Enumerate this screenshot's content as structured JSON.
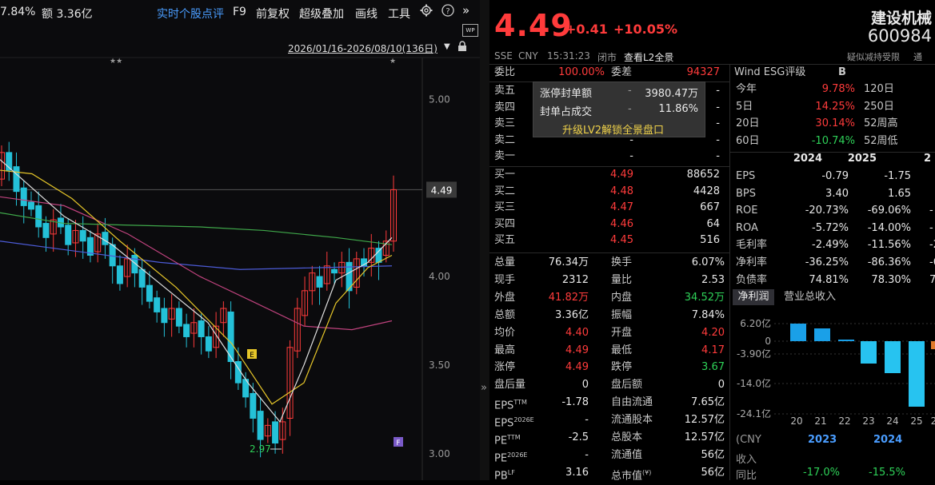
{
  "chart": {
    "toolbar": {
      "left_text_pct": "7.84%",
      "left_text_amount": "额 3.36亿",
      "items": [
        "实时个股点评",
        "F9",
        "前复权",
        "超级叠加",
        "画线",
        "工具"
      ],
      "date_range": "2026/01/16-2026/08/10(136日)",
      "stars_left": "★★",
      "star_right": "★",
      "wp_icon": "WP"
    },
    "price_axis": [
      "5.00",
      "4.49",
      "4.00",
      "3.50",
      "3.00"
    ],
    "current_price_tag": "4.49",
    "low_label": "2.97",
    "marker_e": "E",
    "marker_f": "F",
    "colors": {
      "up": "#ff3b3b",
      "down": "#24c1d8",
      "ma_white": "#e0e0e0",
      "ma_yellow": "#e6c629",
      "ma_magenta": "#c0437e",
      "ma_green": "#3fa84a",
      "ma_blue": "#4c5bd6"
    }
  },
  "chart_data": {
    "type": "candlestick",
    "ylim": [
      2.9,
      5.2
    ],
    "y_ticks": [
      3.0,
      3.5,
      4.0,
      4.49,
      5.0
    ],
    "low_marker": 2.97,
    "current_price": 4.49
  },
  "quote": {
    "price": "4.49",
    "change": "+0.41",
    "change_pct": "+10.05%",
    "name": "建设机械",
    "code": "600984",
    "meta": {
      "exchange": "SSE",
      "currency": "CNY",
      "time": "15:31:23",
      "status": "闭市",
      "l2_link": "查看L2全景",
      "note": "疑似减持受限",
      "note2": "通"
    },
    "order_header": {
      "label": "委比",
      "value": "100.00%",
      "label2": "委差",
      "value2": "94327"
    },
    "asks": [
      {
        "label": "卖五",
        "price": "",
        "vol": "-"
      },
      {
        "label": "卖四",
        "price": "",
        "vol": "-"
      },
      {
        "label": "卖三",
        "price": "-",
        "vol": "-"
      },
      {
        "label": "卖二",
        "price": "-",
        "vol": "-"
      },
      {
        "label": "卖一",
        "price": "-",
        "vol": "-"
      }
    ],
    "popup": {
      "row1_label": "涨停封单额",
      "row1_dash": "-",
      "row1_value": "3980.47万",
      "row2_label": "封单占成交",
      "row2_dash": "-",
      "row2_value": "11.86%",
      "upgrade": "升级LV2解锁全景盘口"
    },
    "bids": [
      {
        "label": "买一",
        "price": "4.49",
        "vol": "88652"
      },
      {
        "label": "买二",
        "price": "4.48",
        "vol": "4428"
      },
      {
        "label": "买三",
        "price": "4.47",
        "vol": "667"
      },
      {
        "label": "买四",
        "price": "4.46",
        "vol": "64"
      },
      {
        "label": "买五",
        "price": "4.45",
        "vol": "516"
      }
    ],
    "stats": [
      {
        "l1": "总量",
        "v1": "76.34万",
        "c1": "white",
        "l2": "换手",
        "v2": "6.07%",
        "c2": "white"
      },
      {
        "l1": "现手",
        "v1": "2312",
        "c1": "white",
        "l2": "量比",
        "v2": "2.53",
        "c2": "white"
      },
      {
        "l1": "外盘",
        "v1": "41.82万",
        "c1": "red",
        "l2": "内盘",
        "v2": "34.52万",
        "c2": "green"
      },
      {
        "l1": "总额",
        "v1": "3.36亿",
        "c1": "white",
        "l2": "振幅",
        "v2": "7.84%",
        "c2": "white"
      },
      {
        "l1": "均价",
        "v1": "4.40",
        "c1": "red",
        "l2": "开盘",
        "v2": "4.20",
        "c2": "red"
      },
      {
        "l1": "最高",
        "v1": "4.49",
        "c1": "red",
        "l2": "最低",
        "v2": "4.17",
        "c2": "red"
      },
      {
        "l1": "涨停",
        "v1": "4.49",
        "c1": "red",
        "l2": "跌停",
        "v2": "3.67",
        "c2": "green"
      },
      {
        "l1": "盘后量",
        "v1": "0",
        "c1": "white",
        "l2": "盘后额",
        "v2": "0",
        "c2": "white"
      },
      {
        "l1": "EPS",
        "sup1": "TTM",
        "v1": "-1.78",
        "c1": "white",
        "l2": "自由流通",
        "v2": "7.65亿",
        "c2": "white"
      },
      {
        "l1": "EPS",
        "sup1": "2026E",
        "v1": "-",
        "c1": "white",
        "l2": "流通股本",
        "v2": "12.57亿",
        "c2": "white"
      },
      {
        "l1": "PE",
        "sup1": "TTM",
        "v1": "-2.5",
        "c1": "white",
        "l2": "总股本",
        "v2": "12.57亿",
        "c2": "white"
      },
      {
        "l1": "PE",
        "sup1": "2026E",
        "v1": "-",
        "c1": "white",
        "l2": "流通值",
        "v2": "56亿",
        "c2": "white"
      },
      {
        "l1": "PB",
        "sup1": "LF",
        "v1": "3.16",
        "c1": "white",
        "l2": "总市值",
        "sup2": "(¥)",
        "v2": "56亿",
        "c2": "white"
      }
    ],
    "esg": {
      "label": "Wind ESG评级",
      "grade": "B"
    },
    "periods": [
      {
        "l1": "今年",
        "v1": "9.78%",
        "c1": "red",
        "l2": "120日"
      },
      {
        "l1": "5日",
        "v1": "14.25%",
        "c1": "red",
        "l2": "250日"
      },
      {
        "l1": "20日",
        "v1": "30.14%",
        "c1": "red",
        "l2": "52周高"
      },
      {
        "l1": "60日",
        "v1": "-10.74%",
        "c1": "green",
        "l2": "52周低"
      }
    ],
    "fin_years": [
      "2024",
      "2025",
      "2"
    ],
    "fin_rows": [
      {
        "label": "EPS",
        "a": "-0.79",
        "b": "-1.75"
      },
      {
        "label": "BPS",
        "a": "3.40",
        "b": "1.65"
      },
      {
        "label": "ROE",
        "a": "-20.73%",
        "b": "-69.06%",
        "c": "-"
      },
      {
        "label": "ROA",
        "a": "-5.72%",
        "b": "-14.00%",
        "c": "-"
      },
      {
        "label": "毛利率",
        "a": "-2.49%",
        "b": "-11.56%",
        "c": "-2"
      },
      {
        "label": "净利率",
        "a": "-36.25%",
        "b": "-86.36%",
        "c": "-6"
      },
      {
        "label": "负债率",
        "a": "74.81%",
        "b": "78.30%",
        "c": "7"
      }
    ],
    "mini_tabs": [
      "净利润",
      "营业总收入"
    ],
    "mini_chart": {
      "y_ticks": [
        "6.20亿",
        "0",
        "-3.90亿",
        "-14.0亿",
        "-24.1亿"
      ],
      "x_ticks": [
        "20",
        "21",
        "22",
        "23",
        "24",
        "25",
        "26Q"
      ]
    },
    "bottom": {
      "cny": "(CNY",
      "years": [
        "2023",
        "2024"
      ],
      "rev_label": "收入",
      "yoy_label": "同比",
      "yoy_a": "-17.0%",
      "yoy_b": "-15.5%"
    }
  }
}
